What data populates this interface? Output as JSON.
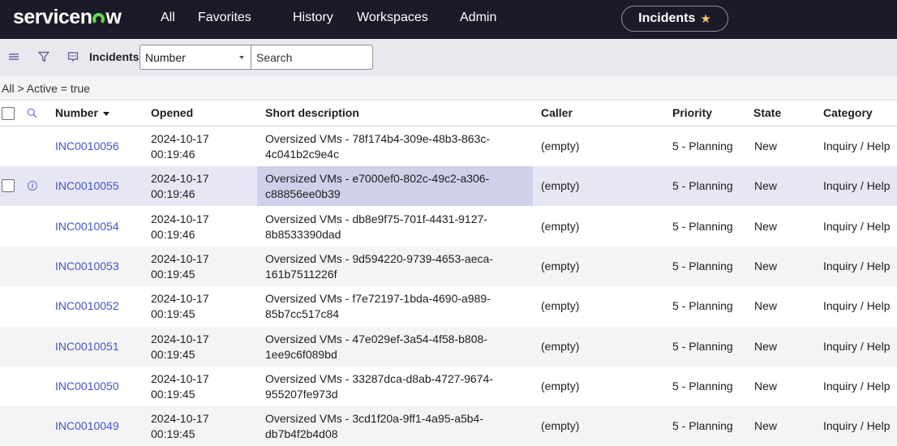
{
  "topnav": {
    "logo_prefix": "servicen",
    "logo_suffix": "w",
    "items": [
      "All",
      "Favorites",
      "History",
      "Workspaces",
      "Admin"
    ],
    "context_pill": "Incidents",
    "context_starred": true
  },
  "toolbar": {
    "title": "Incidents",
    "search_field_selected": "Number",
    "search_placeholder": "Search",
    "search_value": ""
  },
  "breadcrumb": {
    "text": "All > Active = true"
  },
  "table": {
    "columns": [
      "Number",
      "Opened",
      "Short description",
      "Caller",
      "Priority",
      "State",
      "Category"
    ],
    "sorted_column": "Number",
    "sort_direction": "descending",
    "hovered_row_index": 1,
    "rows": [
      {
        "number": "INC0010056",
        "opened_date": "2024-10-17",
        "opened_time": "00:19:46",
        "desc_line1": "Oversized VMs - 78f174b4-309e-48b3-863c-",
        "desc_line2": "4c041b2c9e4c",
        "caller": "(empty)",
        "priority": "5 - Planning",
        "state": "New",
        "category": "Inquiry / Help"
      },
      {
        "number": "INC0010055",
        "opened_date": "2024-10-17",
        "opened_time": "00:19:46",
        "desc_line1": "Oversized VMs - e7000ef0-802c-49c2-a306-",
        "desc_line2": "c88856ee0b39",
        "caller": "(empty)",
        "priority": "5 - Planning",
        "state": "New",
        "category": "Inquiry / Help"
      },
      {
        "number": "INC0010054",
        "opened_date": "2024-10-17",
        "opened_time": "00:19:46",
        "desc_line1": "Oversized VMs - db8e9f75-701f-4431-9127-",
        "desc_line2": "8b8533390dad",
        "caller": "(empty)",
        "priority": "5 - Planning",
        "state": "New",
        "category": "Inquiry / Help"
      },
      {
        "number": "INC0010053",
        "opened_date": "2024-10-17",
        "opened_time": "00:19:45",
        "desc_line1": "Oversized VMs - 9d594220-9739-4653-aeca-",
        "desc_line2": "161b7511226f",
        "caller": "(empty)",
        "priority": "5 - Planning",
        "state": "New",
        "category": "Inquiry / Help"
      },
      {
        "number": "INC0010052",
        "opened_date": "2024-10-17",
        "opened_time": "00:19:45",
        "desc_line1": "Oversized VMs - f7e72197-1bda-4690-a989-",
        "desc_line2": "85b7cc517c84",
        "caller": "(empty)",
        "priority": "5 - Planning",
        "state": "New",
        "category": "Inquiry / Help"
      },
      {
        "number": "INC0010051",
        "opened_date": "2024-10-17",
        "opened_time": "00:19:45",
        "desc_line1": "Oversized VMs - 47e029ef-3a54-4f58-b808-",
        "desc_line2": "1ee9c6f089bd",
        "caller": "(empty)",
        "priority": "5 - Planning",
        "state": "New",
        "category": "Inquiry / Help"
      },
      {
        "number": "INC0010050",
        "opened_date": "2024-10-17",
        "opened_time": "00:19:45",
        "desc_line1": "Oversized VMs - 33287dca-d8ab-4727-9674-",
        "desc_line2": "955207fe973d",
        "caller": "(empty)",
        "priority": "5 - Planning",
        "state": "New",
        "category": "Inquiry / Help"
      },
      {
        "number": "INC0010049",
        "opened_date": "2024-10-17",
        "opened_time": "00:19:45",
        "desc_line1": "Oversized VMs - 3cd1f20a-9ff1-4a95-a5b4-",
        "desc_line2": "db7b4f2b4d08",
        "caller": "(empty)",
        "priority": "5 - Planning",
        "state": "New",
        "category": "Inquiry / Help"
      }
    ]
  },
  "colors": {
    "nav_bg": "#1a1a28",
    "logo_accent": "#62d84e",
    "star": "#f7c96b",
    "link": "#4355c8",
    "row_hover": "#e7e7f4",
    "cell_highlight": "#cfd0ea"
  }
}
